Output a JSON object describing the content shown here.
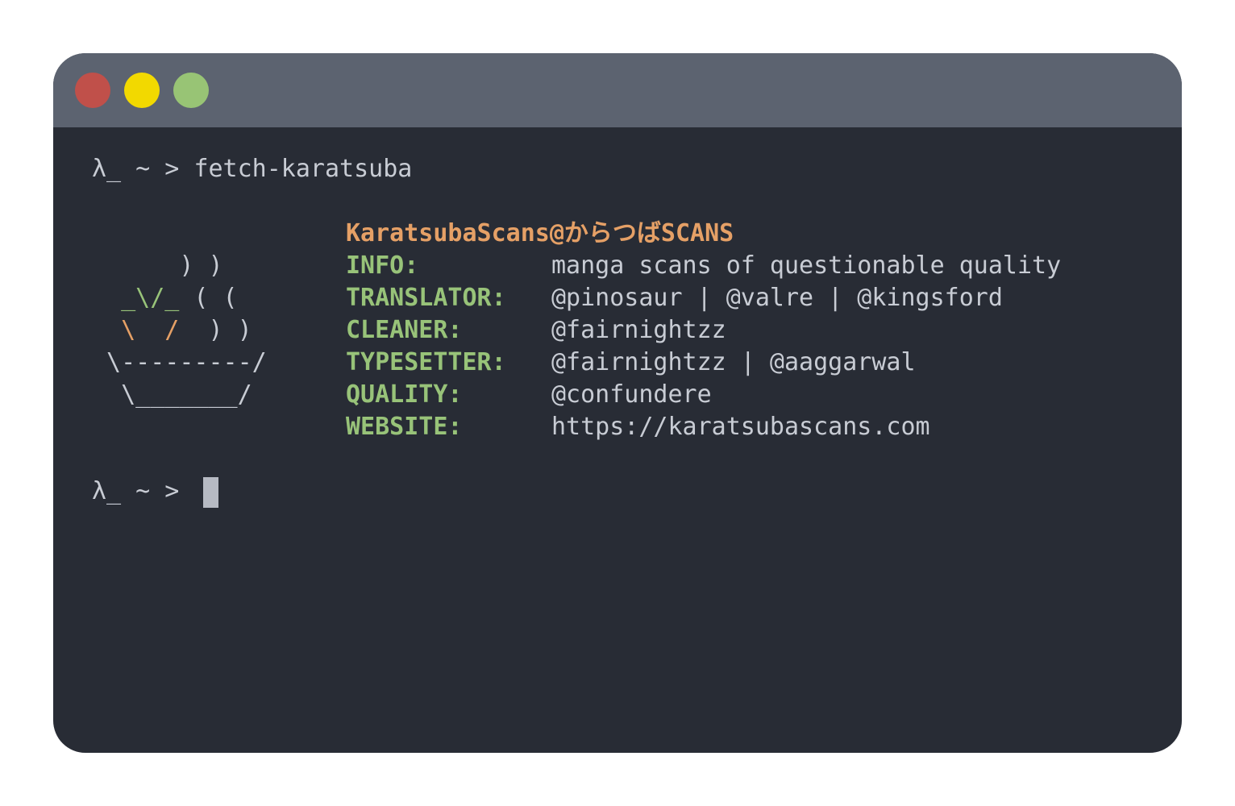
{
  "window": {
    "colors": {
      "titlebar": "#5c6370",
      "background": "#282c35",
      "close": "#c0504a",
      "minimize": "#f2d900",
      "maximize": "#98c475",
      "label": "#98c379",
      "header": "#e5a066",
      "text": "#c8ccd4"
    }
  },
  "prompt": {
    "symbol": "λ_ ~ > ",
    "command": "fetch-karatsuba"
  },
  "ascii_art": {
    "line1": "      ) )",
    "line2_chop": "  _\\/_",
    "line2_steam": " ( (",
    "line3_bowl": "  \\  / ",
    "line3_steam": " ) )",
    "line4": " \\---------/",
    "line5": "  \\_______/"
  },
  "info": {
    "header": "KaratsubaScans@からつばSCANS",
    "rows": [
      {
        "label": "INFO:",
        "value": "manga scans of questionable quality"
      },
      {
        "label": "TRANSLATOR:",
        "value": "@pinosaur | @valre | @kingsford"
      },
      {
        "label": "CLEANER:",
        "value": "@fairnightzz"
      },
      {
        "label": "TYPESETTER:",
        "value": "@fairnightzz | @aaggarwal"
      },
      {
        "label": "QUALITY:",
        "value": "@confundere"
      },
      {
        "label": "WEBSITE:",
        "value": "https://karatsubascans.com"
      }
    ]
  },
  "prompt2": {
    "symbol": "λ_ ~ > "
  }
}
